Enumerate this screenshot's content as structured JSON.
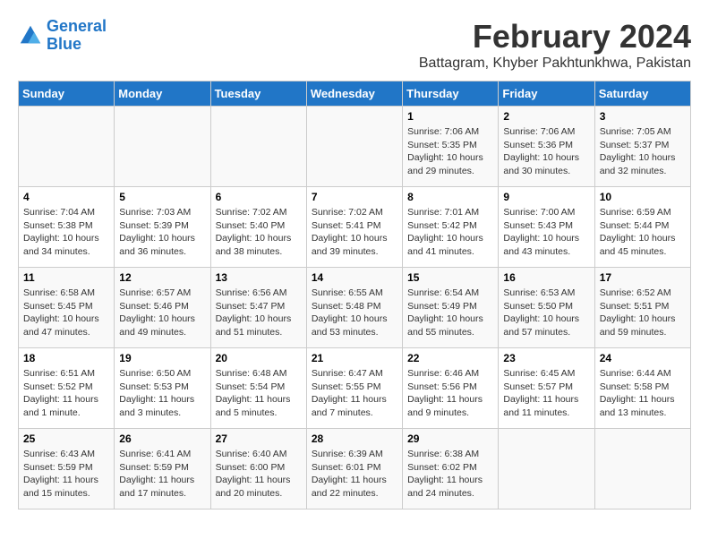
{
  "logo": {
    "line1": "General",
    "line2": "Blue"
  },
  "title": "February 2024",
  "subtitle": "Battagram, Khyber Pakhtunkhwa, Pakistan",
  "weekdays": [
    "Sunday",
    "Monday",
    "Tuesday",
    "Wednesday",
    "Thursday",
    "Friday",
    "Saturday"
  ],
  "weeks": [
    [
      {
        "day": "",
        "info": ""
      },
      {
        "day": "",
        "info": ""
      },
      {
        "day": "",
        "info": ""
      },
      {
        "day": "",
        "info": ""
      },
      {
        "day": "1",
        "info": "Sunrise: 7:06 AM\nSunset: 5:35 PM\nDaylight: 10 hours and 29 minutes."
      },
      {
        "day": "2",
        "info": "Sunrise: 7:06 AM\nSunset: 5:36 PM\nDaylight: 10 hours and 30 minutes."
      },
      {
        "day": "3",
        "info": "Sunrise: 7:05 AM\nSunset: 5:37 PM\nDaylight: 10 hours and 32 minutes."
      }
    ],
    [
      {
        "day": "4",
        "info": "Sunrise: 7:04 AM\nSunset: 5:38 PM\nDaylight: 10 hours and 34 minutes."
      },
      {
        "day": "5",
        "info": "Sunrise: 7:03 AM\nSunset: 5:39 PM\nDaylight: 10 hours and 36 minutes."
      },
      {
        "day": "6",
        "info": "Sunrise: 7:02 AM\nSunset: 5:40 PM\nDaylight: 10 hours and 38 minutes."
      },
      {
        "day": "7",
        "info": "Sunrise: 7:02 AM\nSunset: 5:41 PM\nDaylight: 10 hours and 39 minutes."
      },
      {
        "day": "8",
        "info": "Sunrise: 7:01 AM\nSunset: 5:42 PM\nDaylight: 10 hours and 41 minutes."
      },
      {
        "day": "9",
        "info": "Sunrise: 7:00 AM\nSunset: 5:43 PM\nDaylight: 10 hours and 43 minutes."
      },
      {
        "day": "10",
        "info": "Sunrise: 6:59 AM\nSunset: 5:44 PM\nDaylight: 10 hours and 45 minutes."
      }
    ],
    [
      {
        "day": "11",
        "info": "Sunrise: 6:58 AM\nSunset: 5:45 PM\nDaylight: 10 hours and 47 minutes."
      },
      {
        "day": "12",
        "info": "Sunrise: 6:57 AM\nSunset: 5:46 PM\nDaylight: 10 hours and 49 minutes."
      },
      {
        "day": "13",
        "info": "Sunrise: 6:56 AM\nSunset: 5:47 PM\nDaylight: 10 hours and 51 minutes."
      },
      {
        "day": "14",
        "info": "Sunrise: 6:55 AM\nSunset: 5:48 PM\nDaylight: 10 hours and 53 minutes."
      },
      {
        "day": "15",
        "info": "Sunrise: 6:54 AM\nSunset: 5:49 PM\nDaylight: 10 hours and 55 minutes."
      },
      {
        "day": "16",
        "info": "Sunrise: 6:53 AM\nSunset: 5:50 PM\nDaylight: 10 hours and 57 minutes."
      },
      {
        "day": "17",
        "info": "Sunrise: 6:52 AM\nSunset: 5:51 PM\nDaylight: 10 hours and 59 minutes."
      }
    ],
    [
      {
        "day": "18",
        "info": "Sunrise: 6:51 AM\nSunset: 5:52 PM\nDaylight: 11 hours and 1 minute."
      },
      {
        "day": "19",
        "info": "Sunrise: 6:50 AM\nSunset: 5:53 PM\nDaylight: 11 hours and 3 minutes."
      },
      {
        "day": "20",
        "info": "Sunrise: 6:48 AM\nSunset: 5:54 PM\nDaylight: 11 hours and 5 minutes."
      },
      {
        "day": "21",
        "info": "Sunrise: 6:47 AM\nSunset: 5:55 PM\nDaylight: 11 hours and 7 minutes."
      },
      {
        "day": "22",
        "info": "Sunrise: 6:46 AM\nSunset: 5:56 PM\nDaylight: 11 hours and 9 minutes."
      },
      {
        "day": "23",
        "info": "Sunrise: 6:45 AM\nSunset: 5:57 PM\nDaylight: 11 hours and 11 minutes."
      },
      {
        "day": "24",
        "info": "Sunrise: 6:44 AM\nSunset: 5:58 PM\nDaylight: 11 hours and 13 minutes."
      }
    ],
    [
      {
        "day": "25",
        "info": "Sunrise: 6:43 AM\nSunset: 5:59 PM\nDaylight: 11 hours and 15 minutes."
      },
      {
        "day": "26",
        "info": "Sunrise: 6:41 AM\nSunset: 5:59 PM\nDaylight: 11 hours and 17 minutes."
      },
      {
        "day": "27",
        "info": "Sunrise: 6:40 AM\nSunset: 6:00 PM\nDaylight: 11 hours and 20 minutes."
      },
      {
        "day": "28",
        "info": "Sunrise: 6:39 AM\nSunset: 6:01 PM\nDaylight: 11 hours and 22 minutes."
      },
      {
        "day": "29",
        "info": "Sunrise: 6:38 AM\nSunset: 6:02 PM\nDaylight: 11 hours and 24 minutes."
      },
      {
        "day": "",
        "info": ""
      },
      {
        "day": "",
        "info": ""
      }
    ]
  ]
}
